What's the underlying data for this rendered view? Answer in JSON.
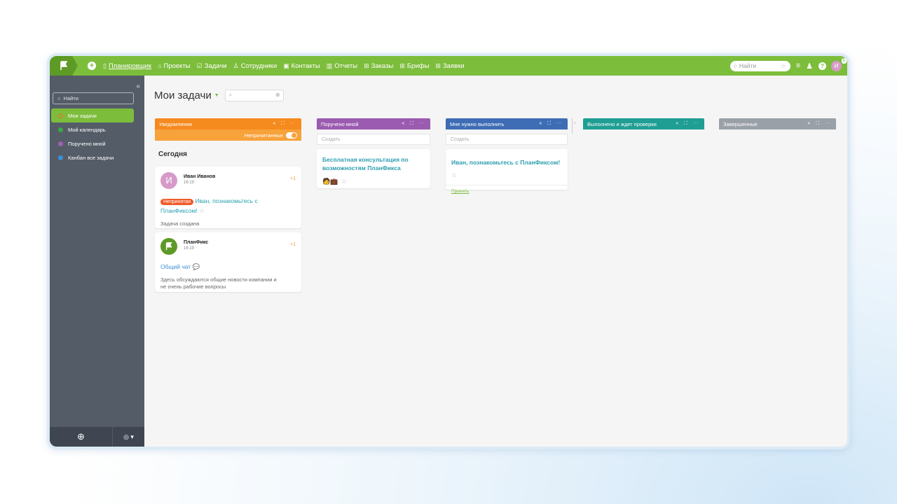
{
  "topbar": {
    "nav": [
      {
        "icon": "calendar-icon",
        "glyph": "▯",
        "label": "Планировщик",
        "active": true
      },
      {
        "icon": "folder-icon",
        "glyph": "⌂",
        "label": "Проекты"
      },
      {
        "icon": "task-icon",
        "glyph": "☑",
        "label": "Задачи"
      },
      {
        "icon": "people-icon",
        "glyph": "♙",
        "label": "Сотрудники"
      },
      {
        "icon": "contacts-icon",
        "glyph": "▣",
        "label": "Контакты"
      },
      {
        "icon": "reports-icon",
        "glyph": "▥",
        "label": "Отчеты"
      },
      {
        "icon": "grid-icon",
        "glyph": "⊞",
        "label": "Заказы"
      },
      {
        "icon": "grid-icon",
        "glyph": "⊞",
        "label": "Брифы"
      },
      {
        "icon": "grid-icon",
        "glyph": "⊞",
        "label": "Заявки"
      }
    ],
    "search_placeholder": "Найти",
    "avatar_letter": "И",
    "avatar_badge": "8"
  },
  "sidebar": {
    "search_placeholder": "Найти",
    "items": [
      {
        "label": "Мои задачи",
        "color": "#f06a2c",
        "active": true
      },
      {
        "label": "Мой календарь",
        "color": "#3aa84a"
      },
      {
        "label": "Поручено мной",
        "color": "#a05fb5"
      },
      {
        "label": "Канбан все задачи",
        "color": "#3a8fd6"
      }
    ]
  },
  "main": {
    "title": "Мои задачи",
    "columns": [
      {
        "title": "Уведомления",
        "color": "#f58a1f"
      },
      {
        "title": "Поручено мной",
        "color": "#9b5bb0"
      },
      {
        "title": "Мне нужно выполнить",
        "color": "#3e6db5"
      },
      {
        "title": "Выполнено и ждет проверки",
        "color": "#1f9e94"
      },
      {
        "title": "Завершенные",
        "color": "#9aa0a8"
      }
    ],
    "notifications": {
      "unread_label": "Непрочитанные",
      "day": "Сегодня",
      "cards": [
        {
          "avatar_letter": "И",
          "avatar_color": "#d69ac8",
          "author": "Иван Иванов",
          "time": "16:19",
          "plus": "+1",
          "tag": "Непринятая",
          "text": "Иван, познакомьтесь с ПланФиксом!",
          "note": "Задача создана"
        },
        {
          "avatar_color": "#5e9a26",
          "author": "ПланФикс",
          "time": "16:19",
          "plus": "+1",
          "text": "Общий чат",
          "note": "Здесь обсуждаются общие новости компании и не очень рабочие вопросы"
        }
      ]
    },
    "create_label": "Создать",
    "assigned_card": {
      "title": "Бесплатная консультация по возможностям ПланФикса"
    },
    "todo_card": {
      "title": "Иван, познакомьтесь с ПланФиксом!",
      "action": "Принять"
    }
  }
}
